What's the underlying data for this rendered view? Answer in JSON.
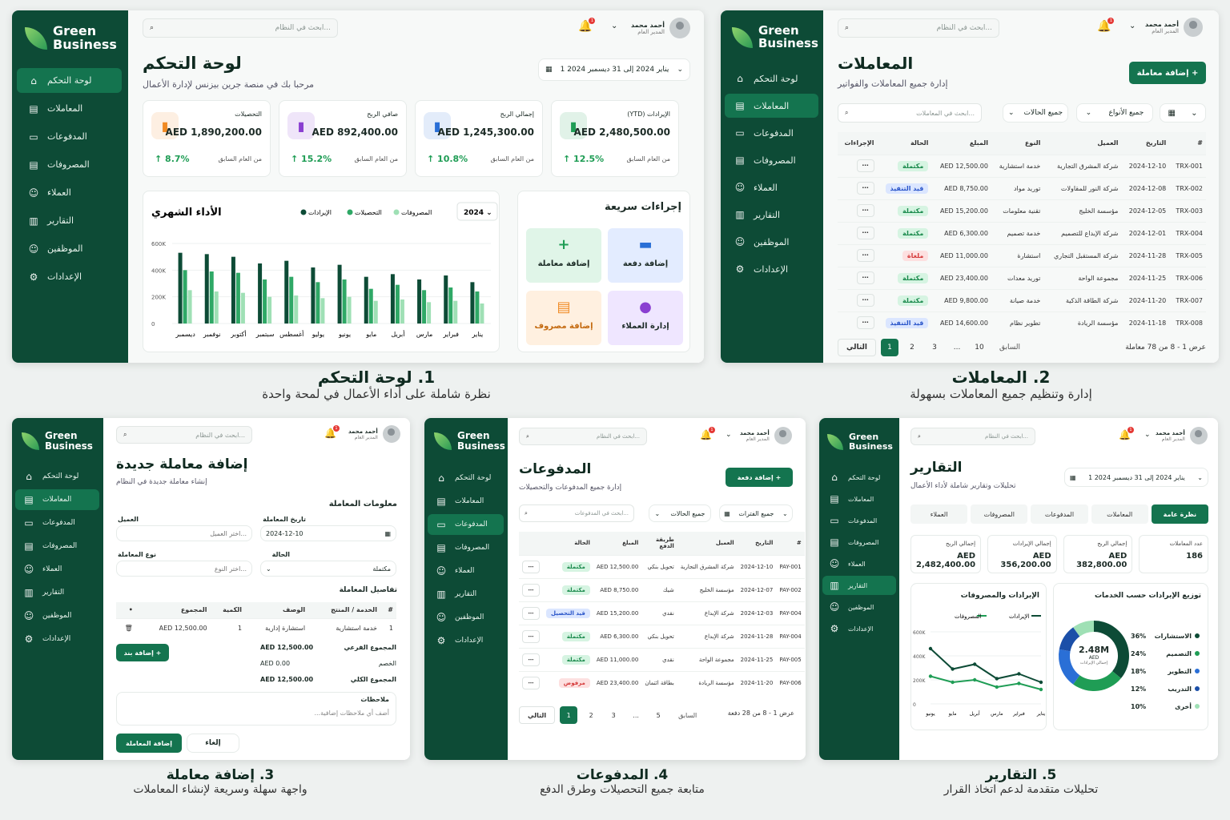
{
  "brand": {
    "line1": "Green",
    "line2": "Business"
  },
  "user": {
    "name": "أحمد محمد",
    "role": "المدير العام"
  },
  "search_placeholder": "ابحث في النظام...",
  "notif_count": "1",
  "nav": {
    "dashboard": "لوحة التحكم",
    "transactions": "المعاملات",
    "payments": "المدفوعات",
    "expenses": "المصروفات",
    "clients": "العملاء",
    "reports": "التقارير",
    "employees": "الموظفين",
    "settings": "الإعدادات"
  },
  "s1": {
    "title": "لوحة التحكم",
    "subtitle": "مرحبا بك في منصة جرين بيزنس لإدارة الأعمال",
    "date_range": "1 يناير 2024 إلى 31 ديسمبر 2024",
    "kpis": [
      {
        "label": "الإيرادات (YTD)",
        "value": "AED 2,480,500.00",
        "change": "12.5%",
        "note": "من العام السابق",
        "color": "#1f9d55"
      },
      {
        "label": "إجمالي الربح",
        "value": "AED 1,245,300.00",
        "change": "10.8%",
        "note": "من العام السابق",
        "color": "#2a6fd6"
      },
      {
        "label": "صافي الربح",
        "value": "AED 892,400.00",
        "change": "15.2%",
        "note": "من العام السابق",
        "color": "#8a3fd1"
      },
      {
        "label": "التحصيلات",
        "value": "AED 1,890,200.00",
        "change": "8.7%",
        "note": "من العام السابق",
        "color": "#f08a24"
      }
    ],
    "chart_title": "الأداء الشهري",
    "chart_year": "2024",
    "quick_title": "إجراءات سريعة",
    "quick": [
      {
        "label": "إضافة دفعة",
        "icon": "▬",
        "bg": "#e3ecff",
        "fg": "#2a6fd6"
      },
      {
        "label": "إضافة معاملة",
        "icon": "+",
        "bg": "#e0f5e8",
        "fg": "#1f9d55"
      },
      {
        "label": "إدارة العملاء",
        "icon": "●",
        "bg": "#efe6ff",
        "fg": "#8a3fd1"
      },
      {
        "label": "إضافة مصروف",
        "icon": "▤",
        "bg": "#fff0e0",
        "fg": "#f08a24"
      }
    ]
  },
  "chart_data": {
    "type": "bar",
    "title": "الأداء الشهري",
    "categories": [
      "يناير",
      "فبراير",
      "مارس",
      "أبريل",
      "مايو",
      "يونيو",
      "يوليو",
      "أغسطس",
      "سبتمبر",
      "أكتوبر",
      "نوفمبر",
      "ديسمبر"
    ],
    "series": [
      {
        "name": "الإيرادات",
        "color": "#0d4b36",
        "values": [
          310000,
          360000,
          330000,
          370000,
          350000,
          440000,
          420000,
          470000,
          450000,
          500000,
          520000,
          530000
        ]
      },
      {
        "name": "التحصيلات",
        "color": "#2fa866",
        "values": [
          240000,
          270000,
          250000,
          290000,
          260000,
          330000,
          310000,
          350000,
          330000,
          380000,
          390000,
          400000
        ]
      },
      {
        "name": "المصروفات",
        "color": "#9fe0b5",
        "values": [
          150000,
          170000,
          160000,
          180000,
          170000,
          200000,
          190000,
          210000,
          200000,
          230000,
          240000,
          250000
        ]
      }
    ],
    "yticks": [
      "600K",
      "400K",
      "200K",
      "0"
    ],
    "ylim": [
      0,
      600000
    ]
  },
  "s2": {
    "title": "المعاملات",
    "subtitle": "إدارة جميع المعاملات والفواتير",
    "add_btn": "إضافة معاملة +",
    "search": "ابحث في المعاملات...",
    "filter_status": "جميع الحالات",
    "filter_type": "جميع الأنواع",
    "headers": [
      "#",
      "التاريخ",
      "العميل",
      "النوع",
      "المبلغ",
      "الحالة",
      "الإجراءات"
    ],
    "rows": [
      {
        "id": "TRX-001",
        "date": "2024-12-10",
        "client": "شركة المشرق التجارية",
        "type": "خدمة استشارية",
        "amount": "AED 12,500.00",
        "status": "مكتملة",
        "cls": "p-done"
      },
      {
        "id": "TRX-002",
        "date": "2024-12-08",
        "client": "شركة النور للمقاولات",
        "type": "توريد مواد",
        "amount": "AED 8,750.00",
        "status": "قيد التنفيذ",
        "cls": "p-prog"
      },
      {
        "id": "TRX-003",
        "date": "2024-12-05",
        "client": "مؤسسة الخليج",
        "type": "تقنية معلومات",
        "amount": "AED 15,200.00",
        "status": "مكتملة",
        "cls": "p-done"
      },
      {
        "id": "TRX-004",
        "date": "2024-12-01",
        "client": "شركة الإبداع للتصميم",
        "type": "خدمة تصميم",
        "amount": "AED 6,300.00",
        "status": "مكتملة",
        "cls": "p-done"
      },
      {
        "id": "TRX-005",
        "date": "2024-11-28",
        "client": "شركة المستقبل التجاري",
        "type": "استشارة",
        "amount": "AED 11,000.00",
        "status": "ملغاة",
        "cls": "p-cancel"
      },
      {
        "id": "TRX-006",
        "date": "2024-11-25",
        "client": "مجموعة الواحة",
        "type": "توريد معدات",
        "amount": "AED 23,400.00",
        "status": "مكتملة",
        "cls": "p-done"
      },
      {
        "id": "TRX-007",
        "date": "2024-11-20",
        "client": "شركة الطاقة الذكية",
        "type": "خدمة صيانة",
        "amount": "AED 9,800.00",
        "status": "مكتملة",
        "cls": "p-done"
      },
      {
        "id": "TRX-008",
        "date": "2024-11-18",
        "client": "مؤسسة الريادة",
        "type": "تطوير نظام",
        "amount": "AED 14,600.00",
        "status": "قيد التنفيذ",
        "cls": "p-prog"
      }
    ],
    "summary": "عرض 1 - 8 من 78 معاملة",
    "prev": "السابق",
    "next": "التالي",
    "pages": [
      "10",
      "...",
      "3",
      "2",
      "1"
    ]
  },
  "s3": {
    "title": "إضافة معاملة جديدة",
    "subtitle": "إنشاء معاملة جديدة في النظام",
    "section_info": "معلومات المعاملة",
    "date_label": "تاريخ المعاملة",
    "date_value": "2024-12-10",
    "client_label": "العميل",
    "client_placeholder": "اختر العميل...",
    "status_label": "الحالة",
    "status_value": "مكتملة",
    "type_label": "نوع المعاملة",
    "type_placeholder": "اختر النوع...",
    "section_details": "تفاصيل المعاملة",
    "item_headers": [
      "#",
      "الخدمة / المنتج",
      "الوصف",
      "الكمية",
      "المجموع"
    ],
    "item_row": {
      "n": "1",
      "service": "خدمة استشارية",
      "desc": "استشارة إدارية",
      "qty": "1",
      "total": "AED 12,500.00"
    },
    "add_item": "إضافة بند +",
    "subtotal_label": "المجموع الفرعي",
    "subtotal": "AED 12,500.00",
    "discount_label": "الخصم",
    "discount": "AED 0.00",
    "total_label": "المجموع الكلي",
    "total": "AED 12,500.00",
    "notes_label": "ملاحظات",
    "notes_placeholder": "أضف أي ملاحظات إضافية...",
    "save": "إضافة المعاملة",
    "cancel": "إلغاء"
  },
  "s4": {
    "title": "المدفوعات",
    "subtitle": "إدارة جميع المدفوعات والتحصيلات",
    "add_btn": "إضافة دفعة +",
    "search": "ابحث في المدفوعات...",
    "filter_status": "جميع الحالات",
    "filter_type": "جميع الفترات",
    "headers": [
      "#",
      "التاريخ",
      "العميل",
      "طريقة الدفع",
      "المبلغ",
      "الحالة"
    ],
    "rows": [
      {
        "id": "PAY-001",
        "date": "2024-12-10",
        "client": "شركة المشرق التجارية",
        "method": "تحويل بنكي",
        "amount": "AED 12,500.00",
        "status": "مكتملة",
        "cls": "p-done"
      },
      {
        "id": "PAY-002",
        "date": "2024-12-07",
        "client": "مؤسسة الخليج",
        "method": "شيك",
        "amount": "AED 8,750.00",
        "status": "مكتملة",
        "cls": "p-done"
      },
      {
        "id": "PAY-004",
        "date": "2024-12-03",
        "client": "شركة الإبداع",
        "method": "نقدي",
        "amount": "AED 15,200.00",
        "status": "قيد التحصيل",
        "cls": "p-prog"
      },
      {
        "id": "PAY-004",
        "date": "2024-11-28",
        "client": "شركة الإبداع",
        "method": "تحويل بنكي",
        "amount": "AED 6,300.00",
        "status": "مكتملة",
        "cls": "p-done"
      },
      {
        "id": "PAY-005",
        "date": "2024-11-25",
        "client": "مجموعة الواحة",
        "method": "نقدي",
        "amount": "AED 11,000.00",
        "status": "مكتملة",
        "cls": "p-done"
      },
      {
        "id": "PAY-006",
        "date": "2024-11-20",
        "client": "مؤسسة الريادة",
        "method": "بطاقة ائتمان",
        "amount": "AED 23,400.00",
        "status": "مرفوض",
        "cls": "p-cancel"
      }
    ],
    "summary": "عرض 1 - 8 من 28 دفعة",
    "prev": "السابق",
    "next": "التالي",
    "pages": [
      "5",
      "...",
      "3",
      "2",
      "1"
    ]
  },
  "s5": {
    "title": "التقارير",
    "subtitle": "تحليلات وتقارير شاملة لأداء الأعمال",
    "date_range": "1 يناير 2024 إلى 31 ديسمبر 2024",
    "tabs": [
      "نظرة عامة",
      "المعاملات",
      "المدفوعات",
      "المصروفات",
      "العملاء"
    ],
    "stats": [
      {
        "label": "عدد المعاملات",
        "value": "186"
      },
      {
        "label": "إجمالي الربح",
        "value": "AED 382,800.00"
      },
      {
        "label": "إجمالي الإيرادات",
        "value": "AED 356,200.00"
      },
      {
        "label": "إجمالي الربح",
        "value": "AED 2,482,400.00"
      }
    ],
    "line_title": "الإيرادات والمصروفات",
    "line_legend": [
      "الإيرادات",
      "المصروفات"
    ],
    "line_yticks": [
      "600K",
      "400K",
      "200K",
      "0"
    ],
    "line_months": [
      "يناير",
      "فبراير",
      "مارس",
      "أبريل",
      "مايو",
      "يونيو"
    ],
    "donut_title": "توزيع الإيرادات حسب الخدمات",
    "donut_center": "2.48M",
    "donut_unit": "AED",
    "donut_caption": "إجمالي الإيرادات",
    "donut": [
      {
        "label": "الاستشارات",
        "pct": "36%",
        "v": 36,
        "color": "#0d4b36"
      },
      {
        "label": "التصميم",
        "pct": "24%",
        "v": 24,
        "color": "#1f9d55"
      },
      {
        "label": "التطوير",
        "pct": "18%",
        "v": 18,
        "color": "#2a6fd6"
      },
      {
        "label": "التدريب",
        "pct": "12%",
        "v": 12,
        "color": "#1b4fa8"
      },
      {
        "label": "أخرى",
        "pct": "10%",
        "v": 10,
        "color": "#9fe0b5"
      }
    ]
  },
  "line_series": {
    "revenue": [
      180000,
      250000,
      210000,
      330000,
      290000,
      460000
    ],
    "expenses": [
      120000,
      170000,
      140000,
      200000,
      180000,
      230000
    ]
  },
  "captions": [
    {
      "t": "1. لوحة التحكم",
      "s": "نظرة شاملة على أداء الأعمال في لمحة واحدة"
    },
    {
      "t": "2. المعاملات",
      "s": "إدارة وتنظيم جميع المعاملات بسهولة"
    },
    {
      "t": "3. إضافة معاملة",
      "s": "واجهة سهلة وسريعة لإنشاء المعاملات"
    },
    {
      "t": "4. المدفوعات",
      "s": "متابعة جميع التحصيلات وطرق الدفع"
    },
    {
      "t": "5. التقارير",
      "s": "تحليلات متقدمة لدعم اتخاذ القرار"
    }
  ]
}
